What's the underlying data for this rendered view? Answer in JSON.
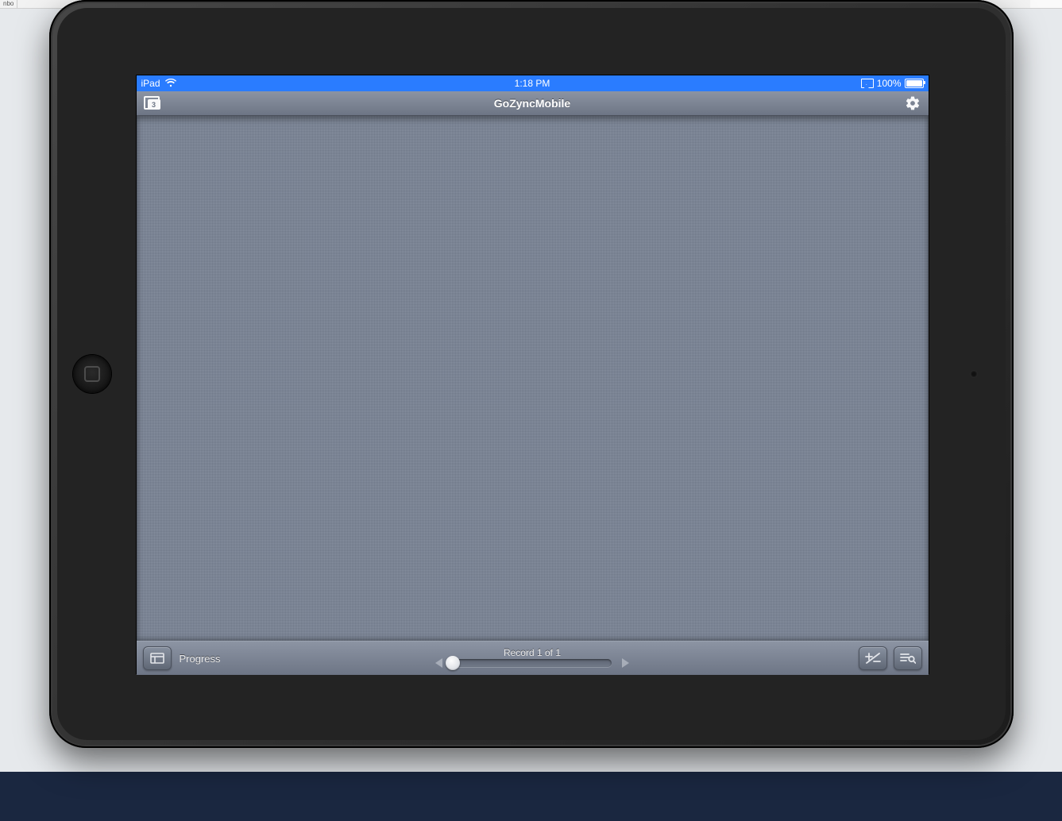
{
  "browser": {
    "tab_fragment": "nbo"
  },
  "statusbar": {
    "device": "iPad",
    "time": "1:18 PM",
    "battery_pct": "100%"
  },
  "navbar": {
    "title": "GoZyncMobile",
    "windows_count": "3"
  },
  "toolbar": {
    "layout_label": "Progress",
    "record_status": "Record 1 of 1"
  }
}
